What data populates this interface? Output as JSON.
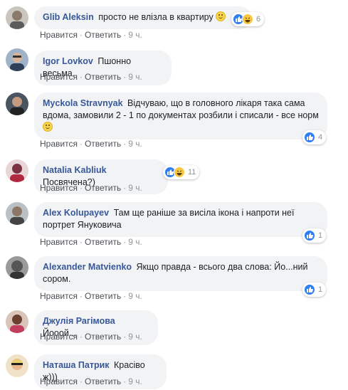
{
  "actions": {
    "like": "Нравится",
    "reply": "Ответить",
    "sep": "·"
  },
  "comments": [
    {
      "author": "Glib Aleksin",
      "text": "просто не влізла в квартиру",
      "emoji": true,
      "reactions": [
        "like",
        "haha"
      ],
      "count": "6",
      "time": "9 ч."
    },
    {
      "author": "Igor Lovkov",
      "text": "Пшонно весьма.",
      "time": "9 ч."
    },
    {
      "author": "Myckola Stravnyak",
      "text": "Відчуваю, що в головного лікаря така сама вдома, замовили 2 - 1 по документах розбили і списали - все норм",
      "emoji": true,
      "reactions": [
        "like"
      ],
      "count": "4",
      "time": "9 ч."
    },
    {
      "author": "Natalia Kabliuk",
      "text": "Посвячена?)",
      "reactions": [
        "like",
        "haha"
      ],
      "count": "11",
      "time": "9 ч."
    },
    {
      "author": "Alex Kolupayev",
      "text": "Там ще раніше за висіла ікона і напроти неї портрет Януковича",
      "reactions": [
        "like"
      ],
      "count": "1",
      "time": "9 ч."
    },
    {
      "author": "Alexander Matvienko",
      "text": "Якщо правда - всього два слова: Йо...ний сором.",
      "reactions": [
        "like"
      ],
      "count": "1",
      "time": "9 ч."
    },
    {
      "author": "Джулія Рагімова",
      "text": "Йооой...",
      "time": "9 ч."
    },
    {
      "author": "Наташа Патрик",
      "text": "Красіво ж)))",
      "time": "9 ч."
    }
  ],
  "colors": {
    "link": "#385898",
    "bubble": "#f2f3f5",
    "like": "#2e7ff5",
    "muted": "#90949c"
  }
}
